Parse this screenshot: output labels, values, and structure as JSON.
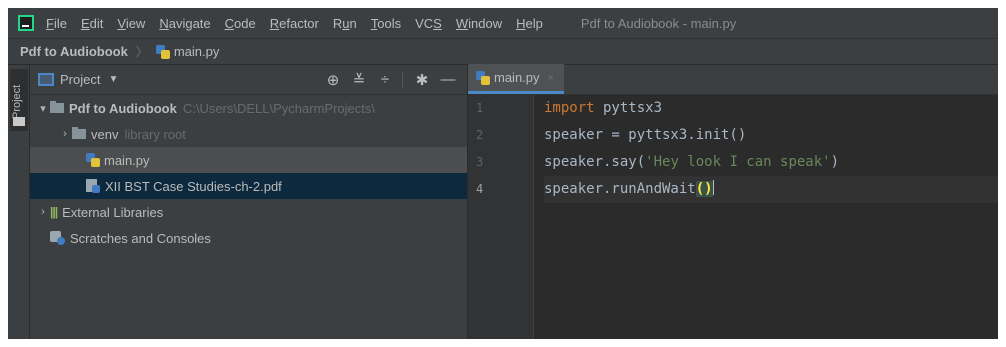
{
  "menubar": {
    "items": [
      {
        "label": "File",
        "mnemonic": "F"
      },
      {
        "label": "Edit",
        "mnemonic": "E"
      },
      {
        "label": "View",
        "mnemonic": "V"
      },
      {
        "label": "Navigate",
        "mnemonic": "N"
      },
      {
        "label": "Code",
        "mnemonic": "C"
      },
      {
        "label": "Refactor",
        "mnemonic": "R"
      },
      {
        "label": "Run",
        "mnemonic": "u"
      },
      {
        "label": "Tools",
        "mnemonic": "T"
      },
      {
        "label": "VCS",
        "mnemonic": "S"
      },
      {
        "label": "Window",
        "mnemonic": "W"
      },
      {
        "label": "Help",
        "mnemonic": "H"
      }
    ],
    "window_title": "Pdf to Audiobook - main.py"
  },
  "breadcrumb": {
    "project": "Pdf to Audiobook",
    "separator": "〉",
    "file": "main.py"
  },
  "toolstrip": {
    "project_tab": "Project"
  },
  "project_panel": {
    "title": "Project",
    "tools": [
      "target-icon",
      "expand-all-icon",
      "collapse-all-icon",
      "gear-icon",
      "hide-icon"
    ],
    "tree": [
      {
        "label": "Pdf to Audiobook",
        "hint": "C:\\Users\\DELL\\PycharmProjects\\",
        "arrow": "▾",
        "icon": "folder-icon",
        "depth": 0
      },
      {
        "label": "venv",
        "hint": "library root",
        "arrow": "›",
        "icon": "folder-icon",
        "depth": 1
      },
      {
        "label": "main.py",
        "hint": "",
        "arrow": "",
        "icon": "python-file-icon",
        "depth": 1
      },
      {
        "label": "XII BST Case Studies-ch-2.pdf",
        "hint": "",
        "arrow": "",
        "icon": "pdf-file-icon",
        "depth": 1,
        "selected": true
      },
      {
        "label": "External Libraries",
        "hint": "",
        "arrow": "›",
        "icon": "libraries-icon",
        "depth": 0
      },
      {
        "label": "Scratches and Consoles",
        "hint": "",
        "arrow": "",
        "icon": "scratches-icon",
        "depth": 0
      }
    ]
  },
  "editor": {
    "tab": {
      "label": "main.py",
      "close": "×"
    },
    "lines": [
      {
        "no": "1",
        "keyword": "import",
        "rest": " pyttsx3"
      },
      {
        "no": "2",
        "text": "speaker = pyttsx3.init()"
      },
      {
        "no": "3",
        "prefix": "speaker.say(",
        "string": "'Hey look I can speak'",
        "suffix": ")"
      },
      {
        "no": "4",
        "prefix": "speaker.runAndWait",
        "paren": "()"
      }
    ],
    "current_line": 4
  },
  "colors": {
    "background": "#2b2b2b",
    "panel": "#3c3f41",
    "keyword": "#cc7832",
    "string": "#6a8759",
    "selection": "#0d293e",
    "accent": "#4a88c7"
  }
}
